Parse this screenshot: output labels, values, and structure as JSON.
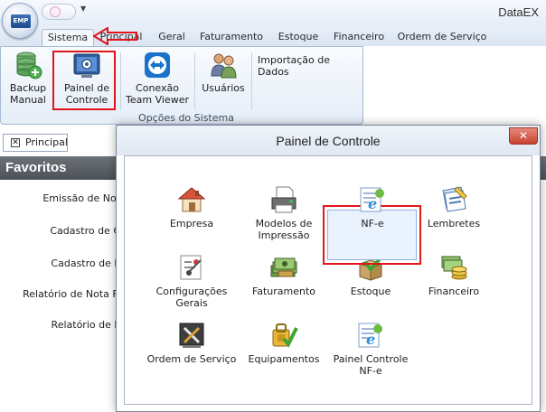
{
  "app": {
    "title": "DataEX",
    "logo_text": "EMP"
  },
  "tabs": [
    {
      "label": "Sistema"
    },
    {
      "label": "Principal"
    },
    {
      "label": "Geral"
    },
    {
      "label": "Faturamento"
    },
    {
      "label": "Estoque"
    },
    {
      "label": "Financeiro"
    },
    {
      "label": "Ordem de Serviço"
    }
  ],
  "ribbon": {
    "backup": {
      "line1": "Backup",
      "line2": "Manual",
      "icon": "database-add-icon"
    },
    "painel": {
      "line1": "Painel de",
      "line2": "Controle",
      "icon": "control-panel-icon"
    },
    "teamviewer": {
      "line1": "Conexão",
      "line2": "Team Viewer",
      "icon": "teamviewer-icon"
    },
    "usuarios": {
      "line1": "Usuários",
      "icon": "users-icon"
    },
    "importacao": {
      "label": "Importação de Dados"
    },
    "group_label": "Opções do Sistema"
  },
  "document_tab": {
    "label": "Principal"
  },
  "favoritos": {
    "title": "Favoritos",
    "items": [
      "Emissão de Not",
      "Cadastro de C",
      "Cadastro de P",
      "Relatório de Nota Fi",
      "Relatório de P"
    ]
  },
  "dialog": {
    "title": "Painel de Controle",
    "close_glyph": "✕",
    "items": [
      {
        "line1": "Empresa",
        "line2": "",
        "icon": "house-icon"
      },
      {
        "line1": "Modelos de",
        "line2": "Impressão",
        "icon": "printer-icon"
      },
      {
        "line1": "NF-e",
        "line2": "",
        "icon": "nfe-icon"
      },
      {
        "line1": "Lembretes",
        "line2": "",
        "icon": "notes-icon"
      },
      {
        "line1": "Configurações",
        "line2": "Gerais",
        "icon": "settings-icon"
      },
      {
        "line1": "Faturamento",
        "line2": "",
        "icon": "money-icon"
      },
      {
        "line1": "Estoque",
        "line2": "",
        "icon": "stock-box-icon"
      },
      {
        "line1": "Financeiro",
        "line2": "",
        "icon": "coins-icon"
      },
      {
        "line1": "Ordem de Serviço",
        "line2": "",
        "icon": "tools-icon"
      },
      {
        "line1": "Equipamentos",
        "line2": "",
        "icon": "equipment-icon"
      },
      {
        "line1": "Painel Controle",
        "line2": "NF-e",
        "icon": "nfe-panel-icon"
      }
    ]
  },
  "colors": {
    "highlight": "#e0161a",
    "favoritos_bar": "#5a6066",
    "ribbon_border": "#a7bad4"
  }
}
